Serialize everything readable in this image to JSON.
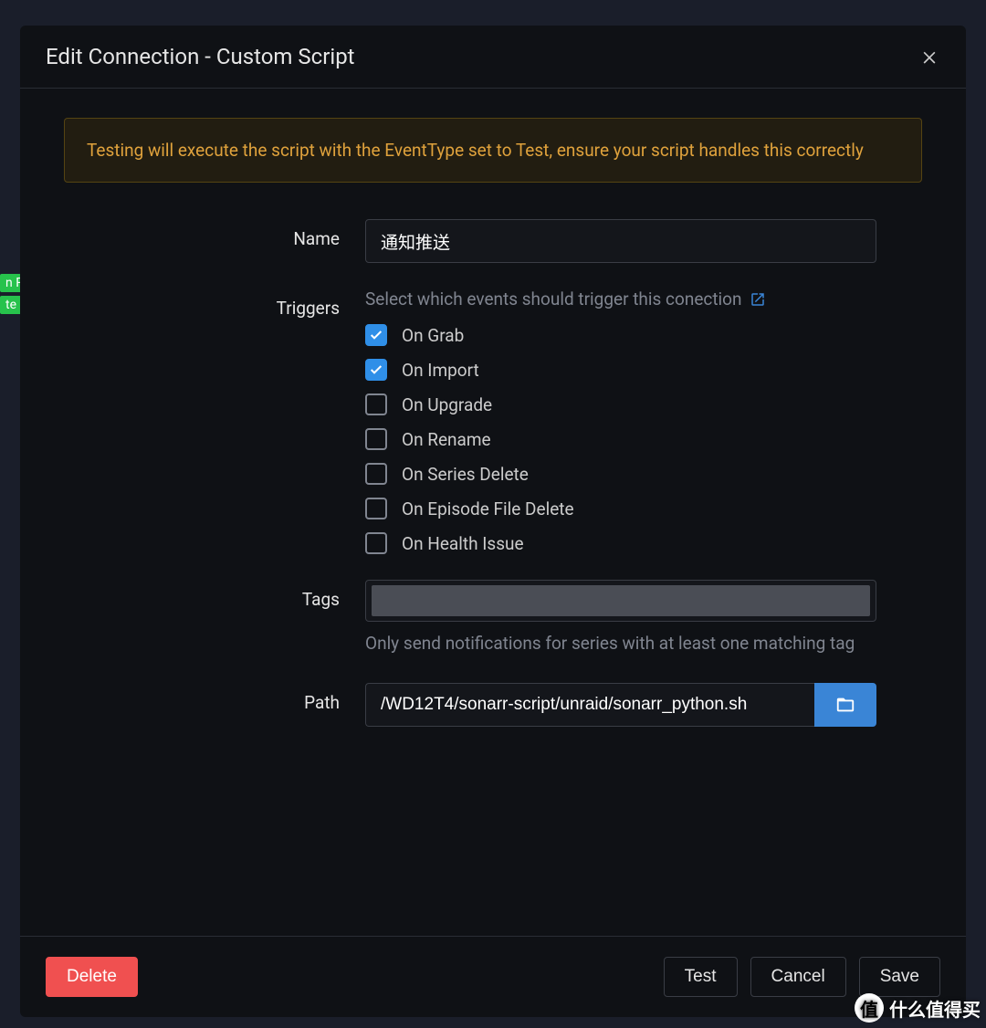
{
  "bg_tags": [
    "n Re",
    "te"
  ],
  "modal": {
    "title": "Edit Connection - Custom Script",
    "alert": "Testing will execute the script with the EventType set to Test, ensure your script handles this correctly",
    "labels": {
      "name": "Name",
      "triggers": "Triggers",
      "tags": "Tags",
      "path": "Path"
    },
    "name_value": "通知推送",
    "triggers_help": "Select which events should trigger this conection",
    "triggers": [
      {
        "label": "On Grab",
        "checked": true
      },
      {
        "label": "On Import",
        "checked": true
      },
      {
        "label": "On Upgrade",
        "checked": false
      },
      {
        "label": "On Rename",
        "checked": false
      },
      {
        "label": "On Series Delete",
        "checked": false
      },
      {
        "label": "On Episode File Delete",
        "checked": false
      },
      {
        "label": "On Health Issue",
        "checked": false
      }
    ],
    "tags_help": "Only send notifications for series with at least one matching tag",
    "path_value": "/WD12T4/sonarr-script/unraid/sonarr_python.sh",
    "buttons": {
      "delete": "Delete",
      "test": "Test",
      "cancel": "Cancel",
      "save": "Save"
    }
  },
  "watermark": {
    "icon": "值",
    "text": "什么值得买"
  }
}
